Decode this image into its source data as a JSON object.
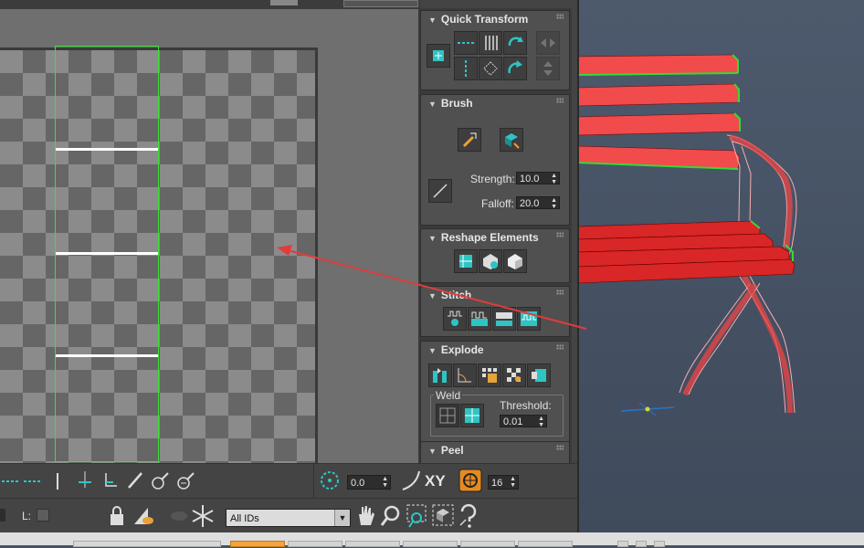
{
  "rollouts": {
    "quick_transform": {
      "title": "Quick Transform"
    },
    "brush": {
      "title": "Brush",
      "strength_label": "Strength:",
      "strength_value": "10.0",
      "falloff_label": "Falloff:",
      "falloff_value": "20.0"
    },
    "reshape": {
      "title": "Reshape Elements"
    },
    "stitch": {
      "title": "Stitch"
    },
    "explode": {
      "title": "Explode",
      "weld_label": "Weld",
      "threshold_label": "Threshold:",
      "threshold_value": "0.01"
    },
    "peel": {
      "title": "Peel"
    }
  },
  "bottom_toolbar": {
    "rotate_value": "0.0",
    "xy_label": "XY",
    "snap_value": "16"
  },
  "status_bar": {
    "l_label": "L:",
    "ids_dropdown": "All IDs"
  },
  "colors": {
    "accent_teal": "#2fc4c4",
    "uv_selection": "#38e038",
    "arrow_red": "#e23b3b",
    "bench_red": "#f04545"
  },
  "icons": [
    "snap-icon",
    "move-icon",
    "rotate-icon",
    "scale-icon",
    "lock-icon",
    "eye-icon",
    "freeze-icon",
    "pan-hand-icon",
    "zoom-icon",
    "zoom-region-icon",
    "frame-icon",
    "help-icon"
  ]
}
